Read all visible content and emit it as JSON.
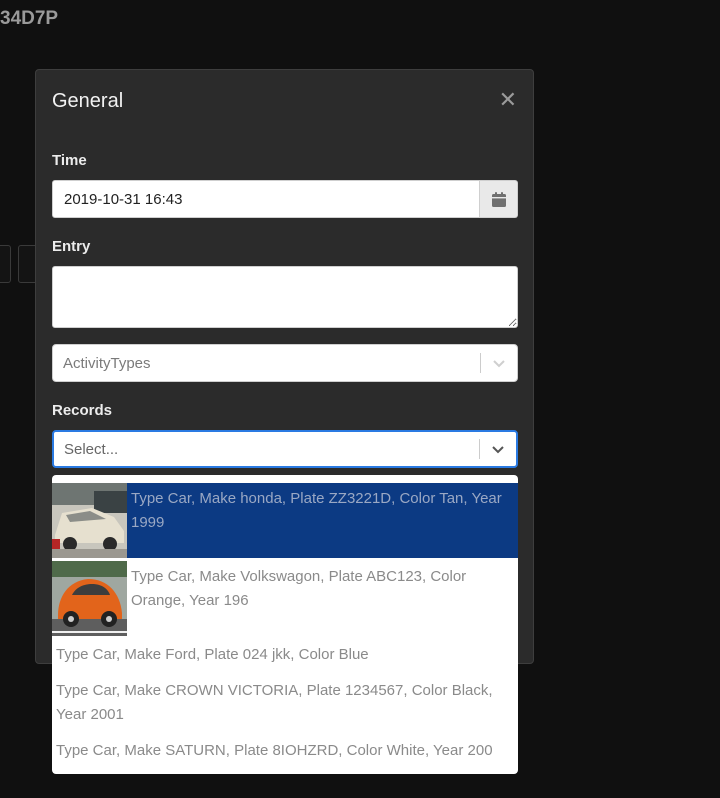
{
  "page": {
    "record_id": "34D7P"
  },
  "modal": {
    "title": "General",
    "close_icon": "close-icon",
    "time": {
      "label": "Time",
      "value": "2019-10-31 16:43",
      "icon": "calendar-icon"
    },
    "entry": {
      "label": "Entry",
      "value": ""
    },
    "activity_types": {
      "placeholder": "ActivityTypes",
      "icon": "chevron-down-icon"
    },
    "records": {
      "label": "Records",
      "placeholder": "Select...",
      "icon": "chevron-down-icon"
    }
  },
  "records_menu": {
    "options": [
      {
        "label": "Type Car, Make honda, Plate ZZ3221D, Color Tan, Year 1999",
        "has_thumbnail": true,
        "focused": true
      },
      {
        "label": "Type Car, Make Volkswagon, Plate ABC123, Color Orange, Year 196",
        "has_thumbnail": true,
        "focused": false
      },
      {
        "label": "Type Car, Make Ford, Plate 024 jkk, Color Blue",
        "has_thumbnail": false,
        "focused": false
      },
      {
        "label": "Type Car, Make CROWN VICTORIA, Plate 1234567, Color Black, Year 2001",
        "has_thumbnail": false,
        "focused": false
      },
      {
        "label": "Type Car, Make SATURN, Plate 8IOHZRD, Color White, Year 200",
        "has_thumbnail": false,
        "focused": false
      }
    ]
  },
  "colors": {
    "modal_bg": "#2b2b2b",
    "focus_border": "#2a7ae2",
    "option_focused_bg": "#0c3a83"
  }
}
